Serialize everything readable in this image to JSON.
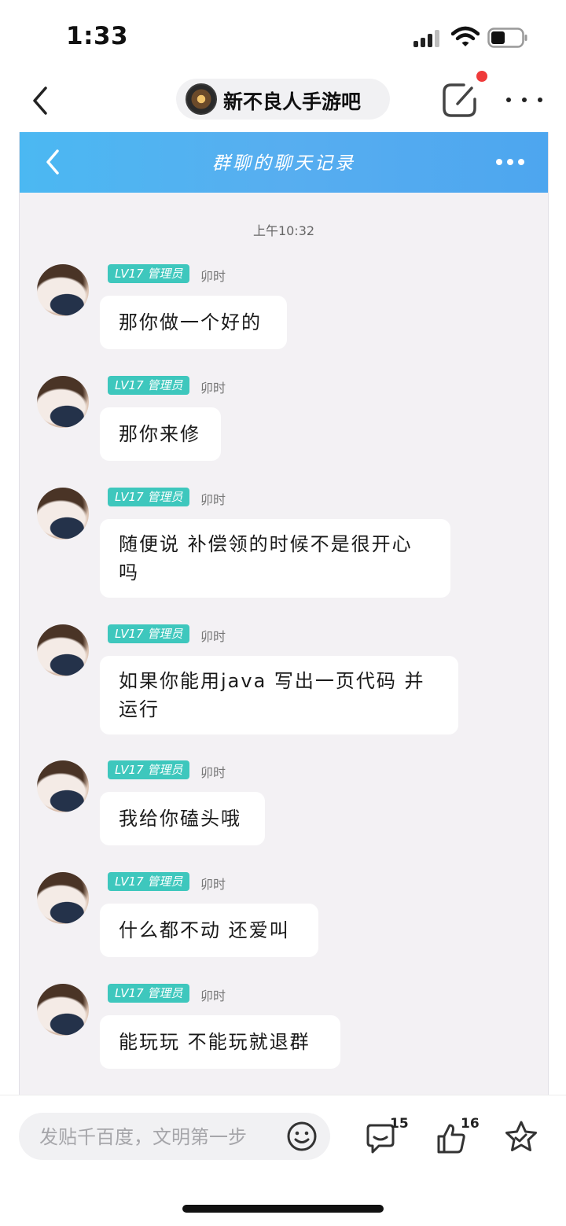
{
  "status_bar": {
    "time": "1:33"
  },
  "header": {
    "forum_name": "新不良人手游吧"
  },
  "screenshot": {
    "title": "群聊的聊天记录",
    "timestamp": "上午10:32",
    "messages": [
      {
        "badge": "LV17 管理员",
        "nick": "卯时",
        "text": "那你做一个好的"
      },
      {
        "badge": "LV17 管理员",
        "nick": "卯时",
        "text": "那你来修"
      },
      {
        "badge": "LV17 管理员",
        "nick": "卯时",
        "line1": "随便说 补偿领的时候不是很开心",
        "line2": "吗"
      },
      {
        "badge": "LV17 管理员",
        "nick": "卯时",
        "line1": "如果你能用java 写出一页代码 并",
        "line2": "运行"
      },
      {
        "badge": "LV17 管理员",
        "nick": "卯时",
        "text": "我给你磕头哦"
      },
      {
        "badge": "LV17 管理员",
        "nick": "卯时",
        "text": "什么都不动 还爱叫"
      },
      {
        "badge": "LV17 管理员",
        "nick": "卯时",
        "text": "能玩玩 不能玩就退群"
      }
    ]
  },
  "bottom_bar": {
    "reply_placeholder": "发贴千百度，文明第一步",
    "comment_count": "15",
    "like_count": "16"
  },
  "colors": {
    "header_gradient": "#4bb8f2",
    "badge": "#3ec7bd",
    "notification_dot": "#ef3a3a"
  },
  "icons": [
    "back-icon",
    "edit-icon",
    "more-icon",
    "emoji-icon",
    "comment-icon",
    "thumbs-up-icon",
    "star-icon"
  ]
}
